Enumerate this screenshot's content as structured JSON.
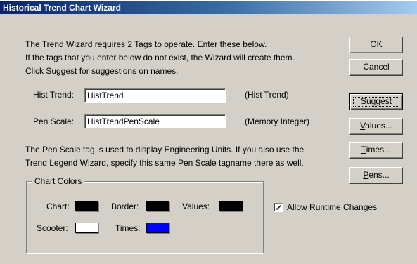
{
  "window": {
    "title": "Historical Trend Chart Wizard"
  },
  "intro": {
    "line1": "The Trend Wizard requires 2 Tags to operate.  Enter these below.",
    "line2": "If the tags that you enter below do not exist, the Wizard will create them.",
    "line3": "Click Suggest for suggestions on names."
  },
  "hist_trend": {
    "label": "Hist Trend:",
    "value": "HistTrend",
    "type": "(Hist Trend)"
  },
  "pen_scale": {
    "label": "Pen Scale:",
    "value": "HistTrendPenScale",
    "type": "(Memory Integer)"
  },
  "note": {
    "line1": "The Pen Scale tag is used to display Engineering Units.  If you also use the",
    "line2": "Trend Legend Wizard, specify this same Pen Scale tagname there as well."
  },
  "buttons": {
    "ok": {
      "pre": "",
      "key": "O",
      "post": "K"
    },
    "cancel": {
      "label": "Cancel"
    },
    "suggest": {
      "pre": "",
      "key": "S",
      "post": "uggest"
    },
    "values": {
      "pre": "",
      "key": "V",
      "post": "alues..."
    },
    "times": {
      "pre": "",
      "key": "T",
      "post": "imes..."
    },
    "pens": {
      "pre": "",
      "key": "P",
      "post": "ens..."
    }
  },
  "chart_colors": {
    "title_pre": "Chart Co",
    "title_key": "l",
    "title_post": "ors",
    "chart": {
      "label": "Chart:",
      "color": "#000000"
    },
    "border": {
      "label": "Border:",
      "color": "#000000"
    },
    "values": {
      "label": "Values:",
      "color": "#000000"
    },
    "scooter": {
      "label": "Scooter:",
      "color": "#ffffff"
    },
    "times": {
      "label": "Times:",
      "color": "#0000ff"
    }
  },
  "allow_runtime": {
    "pre": "",
    "key": "A",
    "post": "llow Runtime Changes",
    "checked": true
  }
}
